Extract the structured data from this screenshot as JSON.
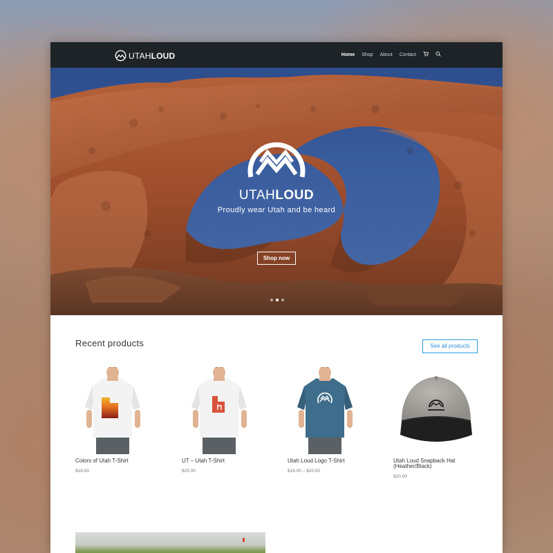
{
  "header": {
    "logo_light": "UTAH",
    "logo_bold": "LOUD",
    "nav": [
      "Home",
      "Shop",
      "About",
      "Contact"
    ],
    "active_nav": "Home",
    "cart_icon": "cart-icon",
    "search_icon": "search-icon"
  },
  "hero": {
    "title_light": "UTAH",
    "title_bold": "LOUD",
    "tagline": "Proudly wear Utah and be heard",
    "button": "Shop now",
    "slides": 3,
    "active_slide": 1
  },
  "recent": {
    "title": "Recent products",
    "see_all": "See all products",
    "products": [
      {
        "name": "Colors of Utah T-Shirt",
        "price": "$18.00"
      },
      {
        "name": "UT – Utah T-Shirt",
        "price": "$25.00"
      },
      {
        "name": "Utah Loud Logo T-Shirt",
        "price": "$18.00 – $20.00"
      },
      {
        "name": "Utah Loud Snapback Hat (Heather/Black)",
        "price": "$20.00"
      }
    ]
  },
  "colors": {
    "topbar": "#1d2327",
    "accent": "#2e9be1",
    "rock": "#a4522f",
    "sky": "#3a5d9e"
  }
}
